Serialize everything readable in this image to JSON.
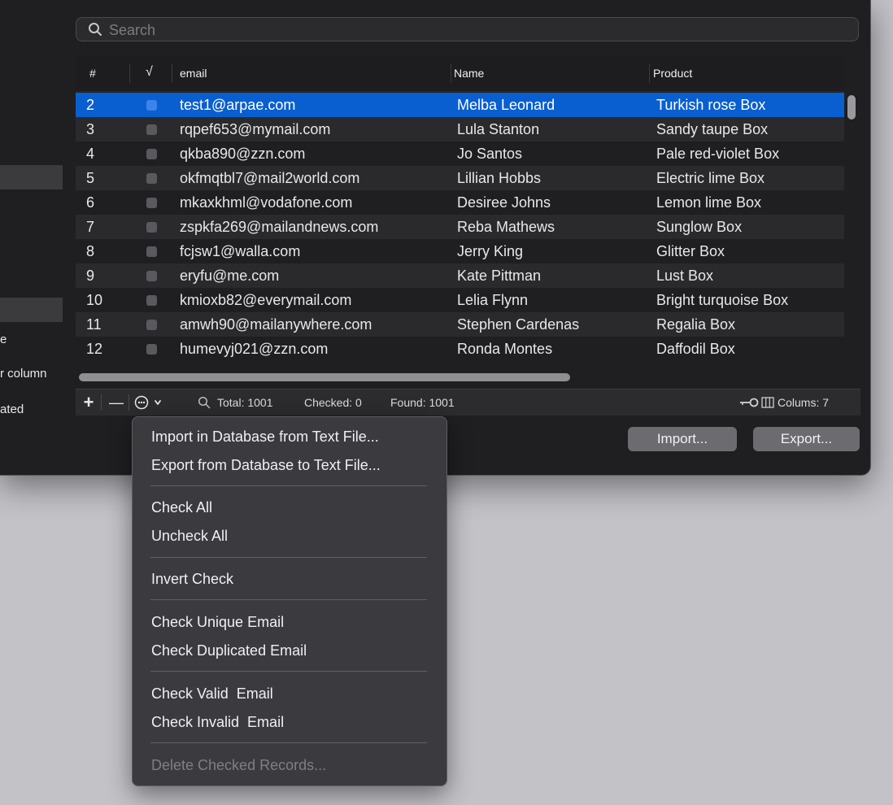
{
  "sidebar": {
    "partial_texts": [
      "e",
      "r column",
      "ated"
    ]
  },
  "search": {
    "placeholder": "Search"
  },
  "table": {
    "headers": {
      "index": "#",
      "check": "√",
      "email": "email",
      "name": "Name",
      "product": "Product"
    },
    "rows": [
      {
        "index": "2",
        "email": "test1@arpae.com",
        "name": "Melba Leonard",
        "product": "Turkish rose Box",
        "selected": true
      },
      {
        "index": "3",
        "email": "rqpef653@mymail.com",
        "name": "Lula Stanton",
        "product": "Sandy taupe Box"
      },
      {
        "index": "4",
        "email": "qkba890@zzn.com",
        "name": "Jo Santos",
        "product": "Pale red-violet Box"
      },
      {
        "index": "5",
        "email": "okfmqtbl7@mail2world.com",
        "name": "Lillian Hobbs",
        "product": "Electric lime Box"
      },
      {
        "index": "6",
        "email": "mkaxkhml@vodafone.com",
        "name": "Desiree Johns",
        "product": "Lemon lime Box"
      },
      {
        "index": "7",
        "email": "zspkfa269@mailandnews.com",
        "name": "Reba Mathews",
        "product": "Sunglow Box"
      },
      {
        "index": "8",
        "email": "fcjsw1@walla.com",
        "name": "Jerry King",
        "product": "Glitter Box"
      },
      {
        "index": "9",
        "email": "eryfu@me.com",
        "name": "Kate Pittman",
        "product": "Lust Box"
      },
      {
        "index": "10",
        "email": "kmioxb82@everymail.com",
        "name": "Lelia Flynn",
        "product": "Bright turquoise Box"
      },
      {
        "index": "11",
        "email": "amwh90@mailanywhere.com",
        "name": "Stephen Cardenas",
        "product": "Regalia Box"
      },
      {
        "index": "12",
        "email": "humevyj021@zzn.com",
        "name": "Ronda Montes",
        "product": "Daffodil Box"
      }
    ]
  },
  "footer": {
    "add": "+",
    "remove": "—",
    "total": "Total: 1001",
    "checked": "Checked: 0",
    "found": "Found: 1001",
    "columns": "Colums: 7"
  },
  "buttons": {
    "import": "Import...",
    "export": "Export..."
  },
  "menu": {
    "import_db": "Import in Database from Text File...",
    "export_db": "Export from Database to Text File...",
    "check_all": "Check All",
    "uncheck_all": "Uncheck All",
    "invert_check": "Invert Check",
    "check_unique": "Check Unique Email",
    "check_duplicated": "Check Duplicated Email",
    "check_valid": "Check Valid  Email",
    "check_invalid": "Check Invalid  Email",
    "delete_checked": "Delete Checked Records..."
  },
  "colors": {
    "selection": "#0a5fd0",
    "window_bg": "#1f1f21",
    "desktop_bg": "#c3c2c7"
  }
}
